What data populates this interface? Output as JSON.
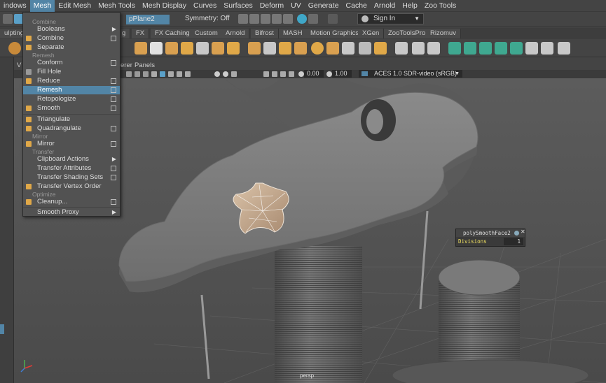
{
  "menubar": {
    "items": [
      "indows",
      "Mesh",
      "Edit Mesh",
      "Mesh Tools",
      "Mesh Display",
      "Curves",
      "Surfaces",
      "Deform",
      "UV",
      "Generate",
      "Cache",
      "Arnold",
      "Help",
      "Zoo Tools"
    ],
    "active_index": 1
  },
  "statusline": {
    "object_field": "pPlane2",
    "symmetry": "Symmetry: Off",
    "signin": "Sign In"
  },
  "shelf_tabs": [
    "ulpting",
    "g",
    "FX",
    "FX Caching",
    "Custom",
    "Arnold",
    "Bifrost",
    "MASH",
    "Motion Graphics",
    "XGen",
    "ZooToolsPro",
    "Rizomuv"
  ],
  "panel_menu": [
    "V",
    "erer",
    "Panels"
  ],
  "panel_tools": {
    "exposure": "0.00",
    "gamma": "1.00",
    "colorspace": "ACES 1.0 SDR-video (sRGB)"
  },
  "mesh_menu": {
    "sections": {
      "combine": "Combine",
      "remesh": "Remesh",
      "mirror": "Mirror",
      "transfer": "Transfer",
      "optimize": "Optimize"
    },
    "items": {
      "booleans": "Booleans",
      "combine": "Combine",
      "separate": "Separate",
      "conform": "Conform",
      "fill_hole": "Fill Hole",
      "reduce": "Reduce",
      "remesh": "Remesh",
      "retopologize": "Retopologize",
      "smooth": "Smooth",
      "triangulate": "Triangulate",
      "quadrangulate": "Quadrangulate",
      "mirror": "Mirror",
      "clipboard_actions": "Clipboard Actions",
      "transfer_attributes": "Transfer Attributes",
      "transfer_shading_sets": "Transfer Shading Sets",
      "transfer_vertex_order": "Transfer Vertex Order",
      "cleanup": "Cleanup...",
      "smooth_proxy": "Smooth Proxy"
    },
    "highlighted": "Remesh"
  },
  "node_panel": {
    "title": "polySmoothFace2",
    "attribute": "Divisions",
    "value": "1"
  },
  "viewport": {
    "camera_label": "persp"
  },
  "colors": {
    "accent": "#5285a6",
    "ui_bg": "#444444",
    "viewport_bg": "#5a5a5a"
  }
}
